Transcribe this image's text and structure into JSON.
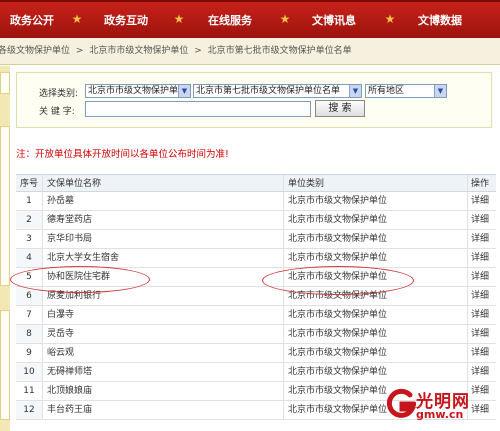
{
  "nav": {
    "tabs": [
      "政务公开",
      "政务互动",
      "在线服务",
      "文博讯息",
      "文博数据"
    ]
  },
  "breadcrumb": {
    "items": [
      "各级文物保护单位",
      "北京市市级文物保护单位",
      "北京市第七批市级文物保护单位名单"
    ],
    "separator": ">"
  },
  "search": {
    "category_label": "选择类别:",
    "keyword_label": "关 键 字:",
    "select1": "北京市市级文物保护单",
    "select2": "北京市第七批市级文物保护单位名单",
    "select3": "所有地区",
    "keyword_value": "",
    "search_button": "搜 索"
  },
  "notice": "注：开放单位具体开放时间以各单位公布时间为准!",
  "table": {
    "headers": [
      "序号",
      "文保单位名称",
      "单位类别",
      "操作"
    ],
    "rows": [
      {
        "no": "1",
        "name": "孙岳墓",
        "category": "北京市市级文物保护单位",
        "action": "详细"
      },
      {
        "no": "2",
        "name": "德寿堂药店",
        "category": "北京市市级文物保护单位",
        "action": "详细"
      },
      {
        "no": "3",
        "name": "京华印书局",
        "category": "北京市市级文物保护单位",
        "action": "详细"
      },
      {
        "no": "4",
        "name": "北京大学女生宿舍",
        "category": "北京市市级文物保护单位",
        "action": "详细"
      },
      {
        "no": "5",
        "name": "协和医院住宅群",
        "category": "北京市市级文物保护单位",
        "action": "详细"
      },
      {
        "no": "6",
        "name": "原麦加利银行",
        "category": "北京市市级文物保护单位",
        "action": "详细"
      },
      {
        "no": "7",
        "name": "白瀑寺",
        "category": "北京市市级文物保护单位",
        "action": "详细"
      },
      {
        "no": "8",
        "name": "灵岳寺",
        "category": "北京市市级文物保护单位",
        "action": "详细"
      },
      {
        "no": "9",
        "name": "峪云观",
        "category": "北京市市级文物保护单位",
        "action": "详细"
      },
      {
        "no": "10",
        "name": "无碍禅师塔",
        "category": "北京市市级文物保护单位",
        "action": "详细"
      },
      {
        "no": "11",
        "name": "北顶娘娘庙",
        "category": "北京市市级文物保护单位",
        "action": "详细"
      },
      {
        "no": "12",
        "name": "丰台药王庙",
        "category": "北京市市级文物保护单位",
        "action": "详细"
      }
    ]
  },
  "logo": {
    "brand": "光明网",
    "domain": "gmw.cn"
  },
  "colors": {
    "nav_red": "#b71a12",
    "notice_red": "#d20000",
    "highlight_red": "#d23c3c"
  }
}
